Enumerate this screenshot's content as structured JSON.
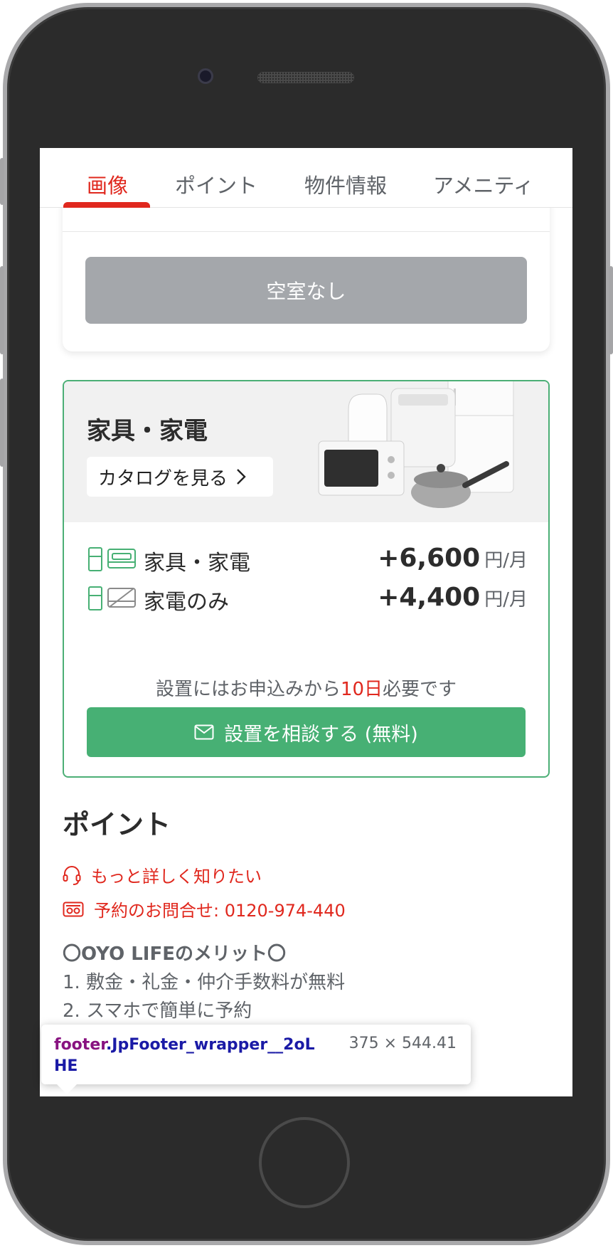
{
  "tabs": [
    "画像",
    "ポイント",
    "物件情報",
    "アメニティ"
  ],
  "vacancy_button": "空室なし",
  "furniture": {
    "title": "家具・家電",
    "catalog_button": "カタログを見る",
    "options": [
      {
        "label": "家具・家電",
        "price": "+6,600",
        "unit": "円/月"
      },
      {
        "label": "家電のみ",
        "price": "+4,400",
        "unit": "円/月"
      }
    ],
    "install_note_before": "設置にはお申込みから",
    "install_note_days": "10日",
    "install_note_after": "必要です",
    "consult_button": "設置を相談する (無料)"
  },
  "points": {
    "title": "ポイント",
    "more_link": "もっと詳しく知りたい",
    "contact_link": "予約のお問合せ: 0120-974-440",
    "merit_heading": "〇OYO LIFEのメリット〇",
    "merit_1": "1. 敷金・礼金・仲介手数料が無料",
    "merit_2": "2. スマホで簡単に予約"
  },
  "tooltip": {
    "tag": "footer",
    "class_name": ".JpFooter_wrapper__2oLHE",
    "size": "375 × 544.41"
  },
  "colors": {
    "accent_red": "#e0281e",
    "green": "#47b074",
    "gray_button": "#a4a7ab"
  }
}
